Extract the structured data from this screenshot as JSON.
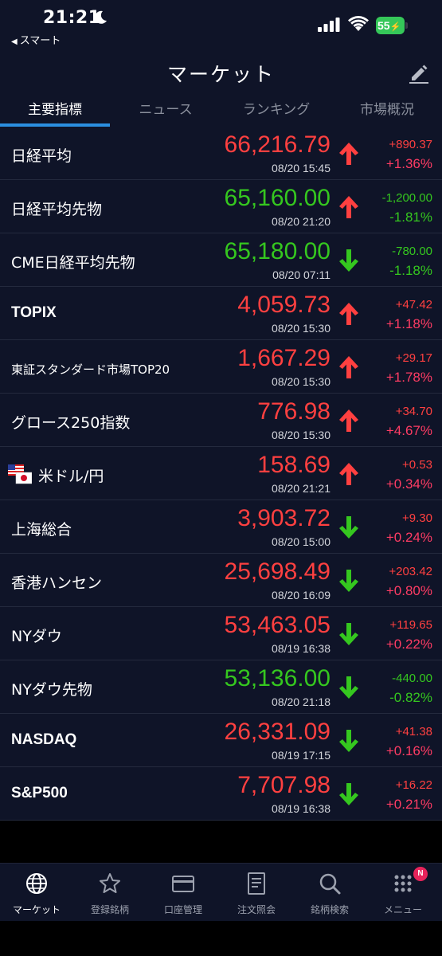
{
  "status": {
    "time": "21:21",
    "back_app": "スマート",
    "battery": "55"
  },
  "header": {
    "title": "マーケット"
  },
  "tabs": [
    {
      "label": "主要指標"
    },
    {
      "label": "ニュース"
    },
    {
      "label": "ランキング"
    },
    {
      "label": "市場概況"
    }
  ],
  "markets": [
    {
      "name": "日経平均",
      "price": "66,216.79",
      "time": "08/20 15:45",
      "change": "+890.37",
      "pct": "+1.36%"
    },
    {
      "name": "日経平均先物",
      "price": "65,160.00",
      "time": "08/20 21:20",
      "change": "-1,200.00",
      "pct": "-1.81%"
    },
    {
      "name": "CME日経平均先物",
      "price": "65,180.00",
      "time": "08/20 07:11",
      "change": "-780.00",
      "pct": "-1.18%"
    },
    {
      "name": "TOPIX",
      "price": "4,059.73",
      "time": "08/20 15:30",
      "change": "+47.42",
      "pct": "+1.18%"
    },
    {
      "name": "東証スタンダード市場TOP20",
      "price": "1,667.29",
      "time": "08/20 15:30",
      "change": "+29.17",
      "pct": "+1.78%"
    },
    {
      "name": "グロース250指数",
      "price": "776.98",
      "time": "08/20 15:30",
      "change": "+34.70",
      "pct": "+4.67%"
    },
    {
      "name": "米ドル/円",
      "price": "158.69",
      "time": "08/20 21:21",
      "change": "+0.53",
      "pct": "+0.34%"
    },
    {
      "name": "上海総合",
      "price": "3,903.72",
      "time": "08/20 15:00",
      "change": "+9.30",
      "pct": "+0.24%"
    },
    {
      "name": "香港ハンセン",
      "price": "25,698.49",
      "time": "08/20 16:09",
      "change": "+203.42",
      "pct": "+0.80%"
    },
    {
      "name": "NYダウ",
      "price": "53,463.05",
      "time": "08/19 16:38",
      "change": "+119.65",
      "pct": "+0.22%"
    },
    {
      "name": "NYダウ先物",
      "price": "53,136.00",
      "time": "08/20 21:18",
      "change": "-440.00",
      "pct": "-0.82%"
    },
    {
      "name": "NASDAQ",
      "price": "26,331.09",
      "time": "08/19 17:15",
      "change": "+41.38",
      "pct": "+0.16%"
    },
    {
      "name": "S&P500",
      "price": "7,707.98",
      "time": "08/19 16:38",
      "change": "+16.22",
      "pct": "+0.21%"
    }
  ],
  "nav": [
    {
      "label": "マーケット",
      "icon": "globe-icon"
    },
    {
      "label": "登録銘柄",
      "icon": "star-icon"
    },
    {
      "label": "口座管理",
      "icon": "card-icon"
    },
    {
      "label": "注文照会",
      "icon": "document-icon"
    },
    {
      "label": "銘柄検索",
      "icon": "search-icon"
    },
    {
      "label": "メニュー",
      "icon": "grid-menu-icon",
      "badge": "N"
    }
  ],
  "colors": {
    "up": "#ff4040",
    "down": "#35c71f",
    "background": "#0f1428",
    "accent": "#2b8fe0"
  }
}
